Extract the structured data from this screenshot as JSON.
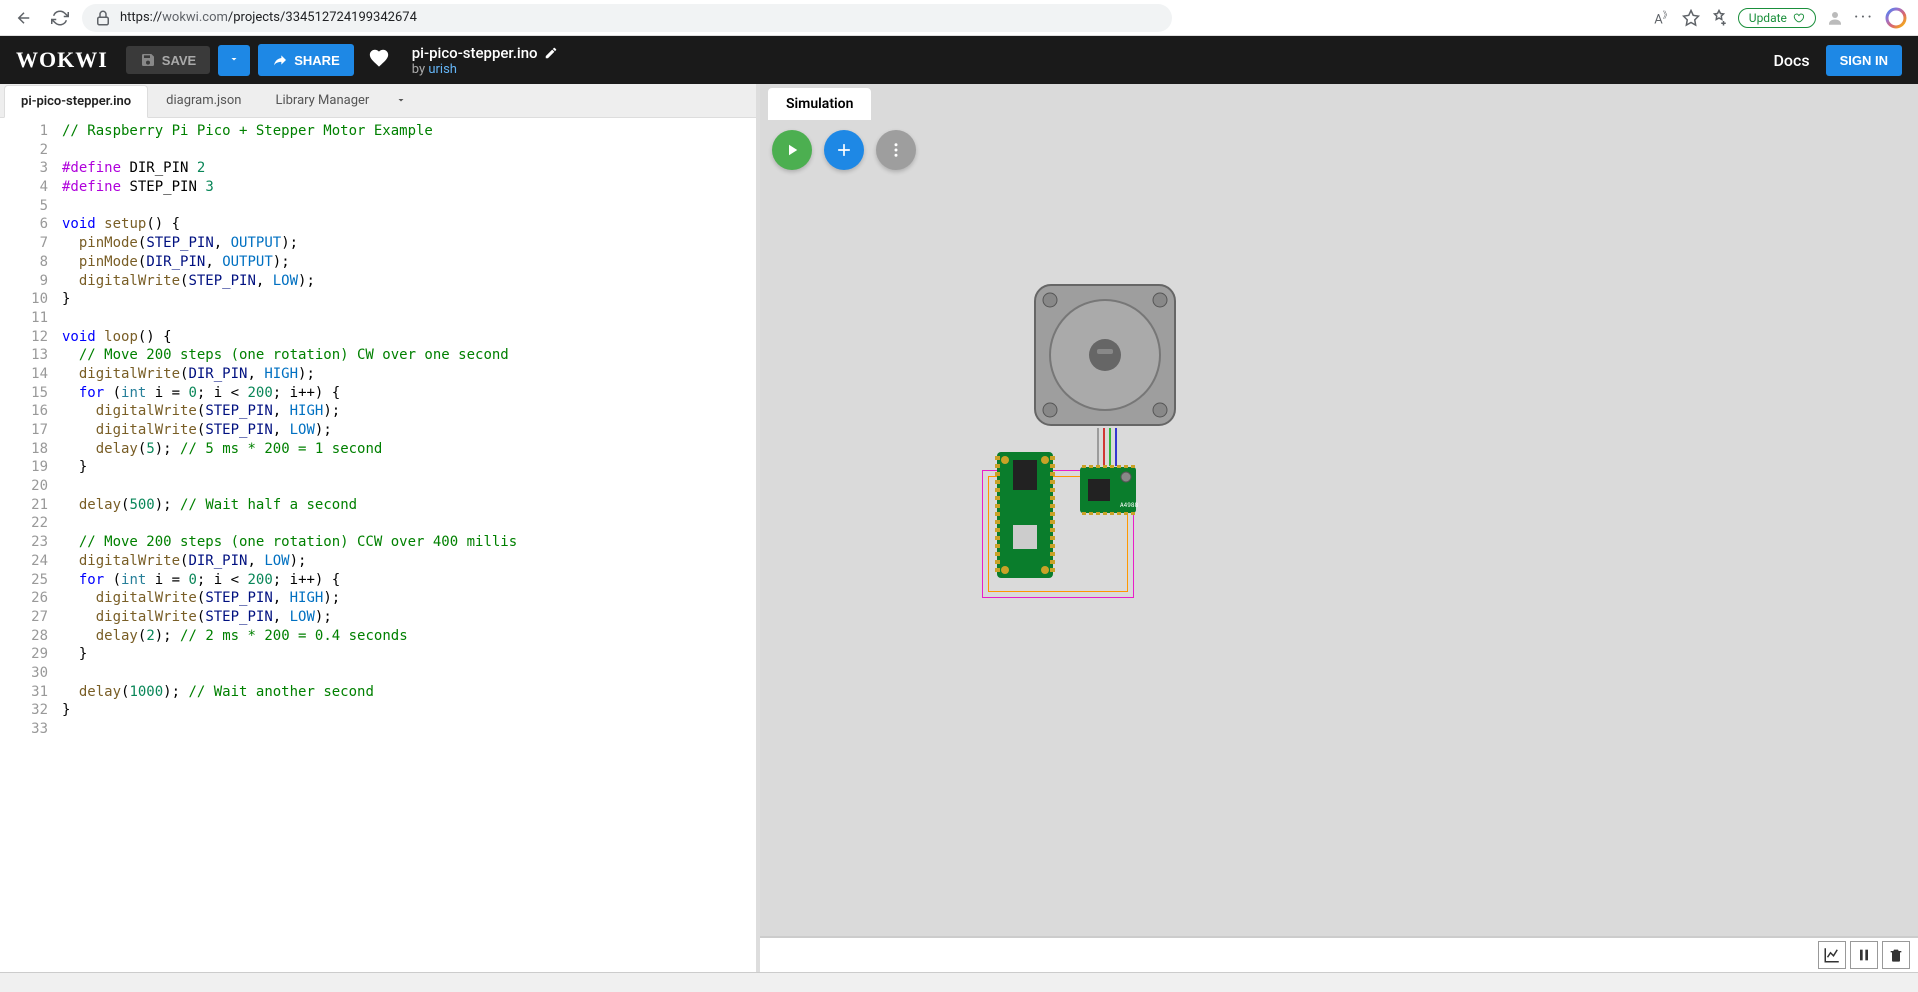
{
  "browser": {
    "url_host": "wokwi.com",
    "url_path": "/projects/334512724199342674",
    "aA": "A",
    "update_label": "Update"
  },
  "wokwi": {
    "logo": "WOKWI",
    "save": "SAVE",
    "share": "SHARE",
    "project_name": "pi-pico-stepper.ino",
    "by_prefix": "by ",
    "author": "urish",
    "docs": "Docs",
    "signin": "SIGN IN"
  },
  "tabs": {
    "sketch": "pi-pico-stepper.ino",
    "diagram": "diagram.json",
    "library": "Library Manager"
  },
  "sim": {
    "tab": "Simulation"
  },
  "code": {
    "lines": 33,
    "src": [
      [
        [
          "comment",
          "// Raspberry Pi Pico + Stepper Motor Example"
        ]
      ],
      [],
      [
        [
          "define",
          "#define"
        ],
        [
          "text",
          " DIR_PIN "
        ],
        [
          "num",
          "2"
        ]
      ],
      [
        [
          "define",
          "#define"
        ],
        [
          "text",
          " STEP_PIN "
        ],
        [
          "num",
          "3"
        ]
      ],
      [],
      [
        [
          "keyword",
          "void"
        ],
        [
          "text",
          " "
        ],
        [
          "func",
          "setup"
        ],
        [
          "punc",
          "() {"
        ]
      ],
      [
        [
          "text",
          "  "
        ],
        [
          "func",
          "pinMode"
        ],
        [
          "punc",
          "("
        ],
        [
          "ident",
          "STEP_PIN"
        ],
        [
          "punc",
          ", "
        ],
        [
          "const",
          "OUTPUT"
        ],
        [
          "punc",
          ");"
        ]
      ],
      [
        [
          "text",
          "  "
        ],
        [
          "func",
          "pinMode"
        ],
        [
          "punc",
          "("
        ],
        [
          "ident",
          "DIR_PIN"
        ],
        [
          "punc",
          ", "
        ],
        [
          "const",
          "OUTPUT"
        ],
        [
          "punc",
          ");"
        ]
      ],
      [
        [
          "text",
          "  "
        ],
        [
          "func",
          "digitalWrite"
        ],
        [
          "punc",
          "("
        ],
        [
          "ident",
          "STEP_PIN"
        ],
        [
          "punc",
          ", "
        ],
        [
          "const",
          "LOW"
        ],
        [
          "punc",
          ");"
        ]
      ],
      [
        [
          "punc",
          "}"
        ]
      ],
      [],
      [
        [
          "keyword",
          "void"
        ],
        [
          "text",
          " "
        ],
        [
          "func",
          "loop"
        ],
        [
          "punc",
          "() {"
        ]
      ],
      [
        [
          "text",
          "  "
        ],
        [
          "comment",
          "// Move 200 steps (one rotation) CW over one second"
        ]
      ],
      [
        [
          "text",
          "  "
        ],
        [
          "func",
          "digitalWrite"
        ],
        [
          "punc",
          "("
        ],
        [
          "ident",
          "DIR_PIN"
        ],
        [
          "punc",
          ", "
        ],
        [
          "const",
          "HIGH"
        ],
        [
          "punc",
          ");"
        ]
      ],
      [
        [
          "text",
          "  "
        ],
        [
          "keyword",
          "for"
        ],
        [
          "punc",
          " ("
        ],
        [
          "type",
          "int"
        ],
        [
          "text",
          " i "
        ],
        [
          "punc",
          "= "
        ],
        [
          "num",
          "0"
        ],
        [
          "punc",
          "; i < "
        ],
        [
          "num",
          "200"
        ],
        [
          "punc",
          "; i++) {"
        ]
      ],
      [
        [
          "text",
          "    "
        ],
        [
          "func",
          "digitalWrite"
        ],
        [
          "punc",
          "("
        ],
        [
          "ident",
          "STEP_PIN"
        ],
        [
          "punc",
          ", "
        ],
        [
          "const",
          "HIGH"
        ],
        [
          "punc",
          ");"
        ]
      ],
      [
        [
          "text",
          "    "
        ],
        [
          "func",
          "digitalWrite"
        ],
        [
          "punc",
          "("
        ],
        [
          "ident",
          "STEP_PIN"
        ],
        [
          "punc",
          ", "
        ],
        [
          "const",
          "LOW"
        ],
        [
          "punc",
          ");"
        ]
      ],
      [
        [
          "text",
          "    "
        ],
        [
          "func",
          "delay"
        ],
        [
          "punc",
          "("
        ],
        [
          "num",
          "5"
        ],
        [
          "punc",
          "); "
        ],
        [
          "comment",
          "// 5 ms * 200 = 1 second"
        ]
      ],
      [
        [
          "text",
          "  "
        ],
        [
          "punc",
          "}"
        ]
      ],
      [],
      [
        [
          "text",
          "  "
        ],
        [
          "func",
          "delay"
        ],
        [
          "punc",
          "("
        ],
        [
          "num",
          "500"
        ],
        [
          "punc",
          "); "
        ],
        [
          "comment",
          "// Wait half a second"
        ]
      ],
      [],
      [
        [
          "text",
          "  "
        ],
        [
          "comment",
          "// Move 200 steps (one rotation) CCW over 400 millis"
        ]
      ],
      [
        [
          "text",
          "  "
        ],
        [
          "func",
          "digitalWrite"
        ],
        [
          "punc",
          "("
        ],
        [
          "ident",
          "DIR_PIN"
        ],
        [
          "punc",
          ", "
        ],
        [
          "const",
          "LOW"
        ],
        [
          "punc",
          ");"
        ]
      ],
      [
        [
          "text",
          "  "
        ],
        [
          "keyword",
          "for"
        ],
        [
          "punc",
          " ("
        ],
        [
          "type",
          "int"
        ],
        [
          "text",
          " i "
        ],
        [
          "punc",
          "= "
        ],
        [
          "num",
          "0"
        ],
        [
          "punc",
          "; i < "
        ],
        [
          "num",
          "200"
        ],
        [
          "punc",
          "; i++) {"
        ]
      ],
      [
        [
          "text",
          "    "
        ],
        [
          "func",
          "digitalWrite"
        ],
        [
          "punc",
          "("
        ],
        [
          "ident",
          "STEP_PIN"
        ],
        [
          "punc",
          ", "
        ],
        [
          "const",
          "HIGH"
        ],
        [
          "punc",
          ");"
        ]
      ],
      [
        [
          "text",
          "    "
        ],
        [
          "func",
          "digitalWrite"
        ],
        [
          "punc",
          "("
        ],
        [
          "ident",
          "STEP_PIN"
        ],
        [
          "punc",
          ", "
        ],
        [
          "const",
          "LOW"
        ],
        [
          "punc",
          ");"
        ]
      ],
      [
        [
          "text",
          "    "
        ],
        [
          "func",
          "delay"
        ],
        [
          "punc",
          "("
        ],
        [
          "num",
          "2"
        ],
        [
          "punc",
          "); "
        ],
        [
          "comment",
          "// 2 ms * 200 = 0.4 seconds"
        ]
      ],
      [
        [
          "text",
          "  "
        ],
        [
          "punc",
          "}"
        ]
      ],
      [],
      [
        [
          "text",
          "  "
        ],
        [
          "func",
          "delay"
        ],
        [
          "punc",
          "("
        ],
        [
          "num",
          "1000"
        ],
        [
          "punc",
          "); "
        ],
        [
          "comment",
          "// Wait another second"
        ]
      ],
      [
        [
          "punc",
          "}"
        ]
      ],
      []
    ]
  }
}
